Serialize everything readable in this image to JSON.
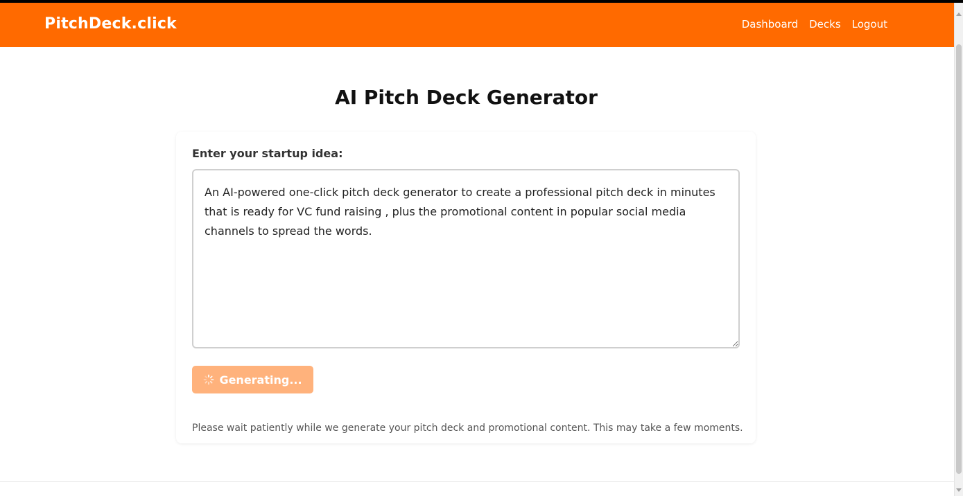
{
  "navbar": {
    "brand": "PitchDeck.click",
    "links": [
      "Dashboard",
      "Decks",
      "Logout"
    ],
    "background_color": "#ff6a00"
  },
  "main": {
    "title": "AI Pitch Deck Generator",
    "form": {
      "label": "Enter your startup idea:",
      "idea_value": "An AI-powered one-click pitch deck generator to create a professional pitch deck in minutes that is ready for VC fund raising , plus the promotional content in popular social media channels to spread the words.",
      "submit_label": "Generating...",
      "submit_icon": "spinner-icon",
      "submit_color": "#ffb27c",
      "wait_note": "Please wait patiently while we generate your pitch deck and promotional content. This may take a few moments."
    }
  }
}
